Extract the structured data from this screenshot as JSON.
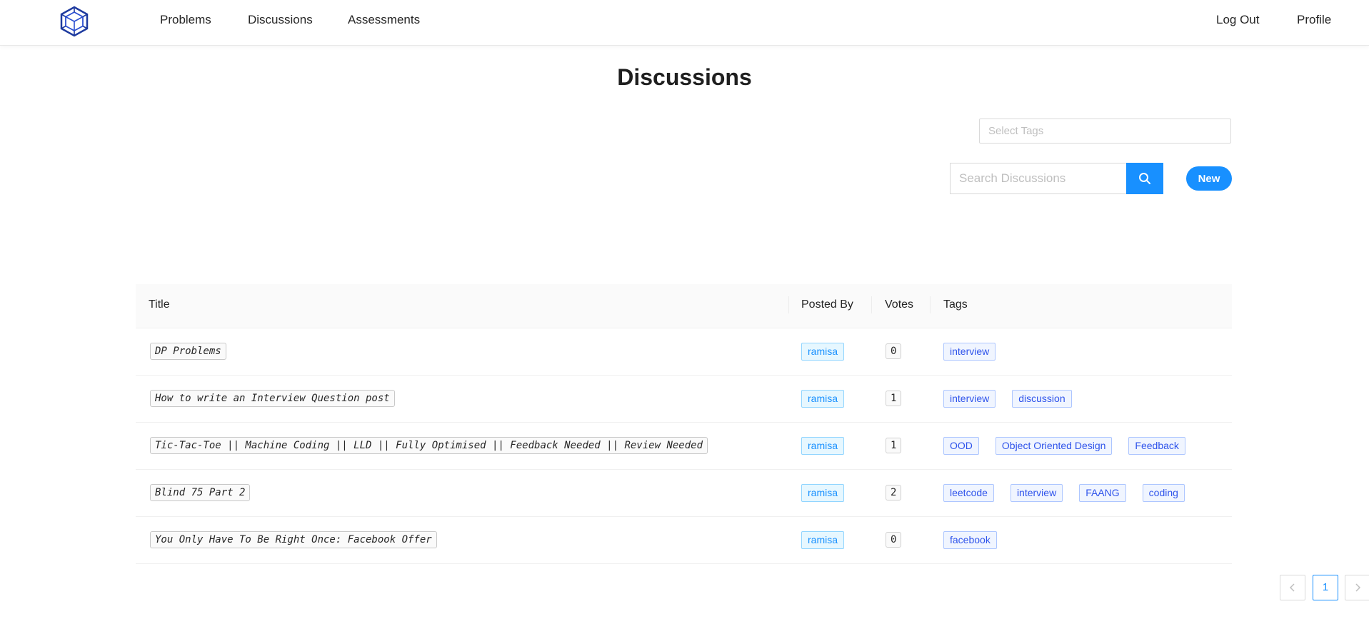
{
  "nav": {
    "links": [
      "Problems",
      "Discussions",
      "Assessments"
    ],
    "log_out": "Log Out",
    "profile": "Profile"
  },
  "page": {
    "title": "Discussions"
  },
  "filters": {
    "tag_placeholder": "Select Tags",
    "search_placeholder": "Search Discussions",
    "new_label": "New"
  },
  "table": {
    "headers": {
      "title": "Title",
      "posted_by": "Posted By",
      "votes": "Votes",
      "tags": "Tags"
    },
    "rows": [
      {
        "title": "DP Problems",
        "posted_by": "ramisa",
        "votes": "0",
        "tags": [
          "interview"
        ]
      },
      {
        "title": "How to write an Interview Question post",
        "posted_by": "ramisa",
        "votes": "1",
        "tags": [
          "interview",
          "discussion"
        ]
      },
      {
        "title": "Tic-Tac-Toe || Machine Coding || LLD || Fully Optimised || Feedback Needed || Review Needed",
        "posted_by": "ramisa",
        "votes": "1",
        "tags": [
          "OOD",
          "Object Oriented Design",
          "Feedback"
        ]
      },
      {
        "title": "Blind 75 Part 2",
        "posted_by": "ramisa",
        "votes": "2",
        "tags": [
          "leetcode",
          "interview",
          "FAANG",
          "coding"
        ]
      },
      {
        "title": "You Only Have To Be Right Once: Facebook Offer",
        "posted_by": "ramisa",
        "votes": "0",
        "tags": [
          "facebook"
        ]
      }
    ]
  },
  "pagination": {
    "prev_icon": "chevron-left-icon",
    "current": "1",
    "next_icon": "chevron-right-icon"
  },
  "colors": {
    "primary": "#1890ff",
    "tag_blue": "#2f54eb",
    "logo": "#1e3a9f"
  }
}
